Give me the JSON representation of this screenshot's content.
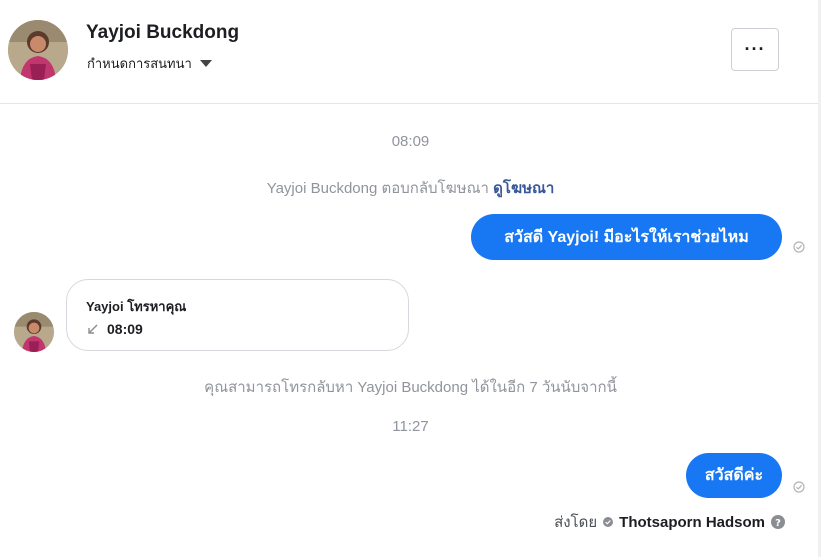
{
  "header": {
    "contact_name": "Yayjoi Buckdong",
    "manage_label": "กำหนดการสนทนา",
    "more_label": "···"
  },
  "conversation": {
    "timestamp_1": "08:09",
    "ad_reply_text": "Yayjoi Buckdong ตอบกลับโฆษณา",
    "ad_link": "ดูโฆษณา",
    "outgoing_1": "สวัสดี Yayjoi! มีอะไรให้เราช่วยไหม",
    "call_card": {
      "title": "Yayjoi โทรหาคุณ",
      "time": "08:09"
    },
    "callback_notice": "คุณสามารถโทรกลับหา Yayjoi Buckdong ได้ในอีก 7 วันนับจากนี้",
    "timestamp_2": "11:27",
    "outgoing_2": "สวัสดีค่ะ",
    "sent_by_label": "ส่งโดย",
    "sent_by_name": "Thotsaporn Hadsom"
  },
  "colors": {
    "accent": "#1877f2",
    "link": "#385898",
    "muted_text": "#90949c"
  },
  "icons": [
    "chevron-down-icon",
    "more-icon",
    "check-circle-icon",
    "missed-call-icon",
    "help-icon"
  ]
}
